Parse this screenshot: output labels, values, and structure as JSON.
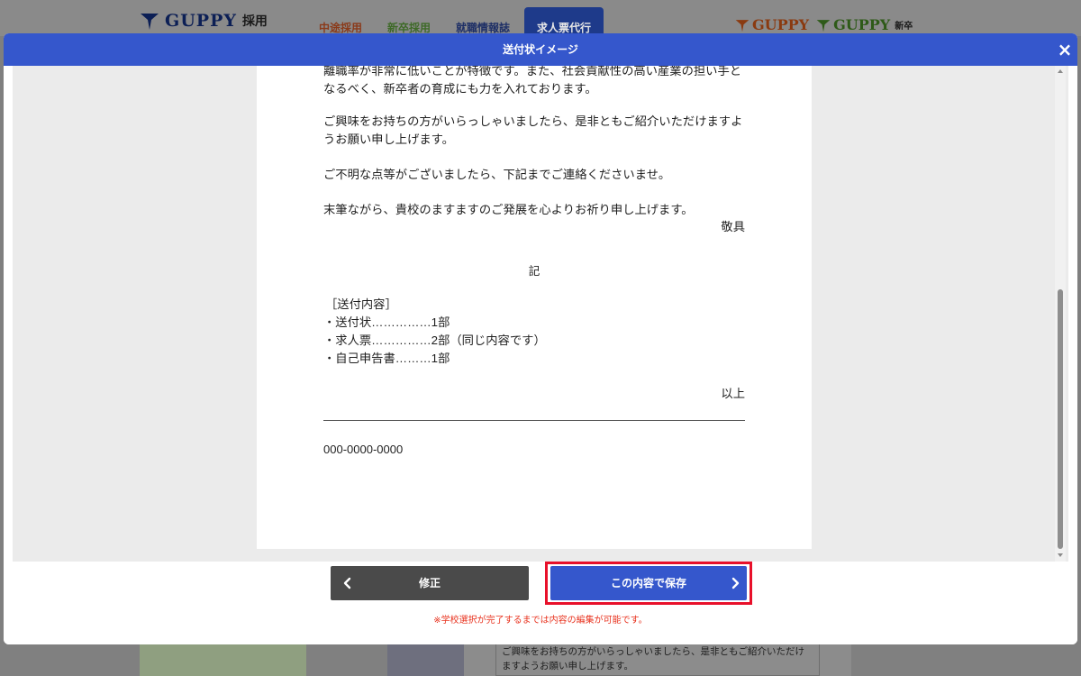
{
  "site": {
    "logo_text": "GUPPY",
    "logo_sub": "採用",
    "nav": [
      "中途採用",
      "新卒採用",
      "就職情報誌",
      "求人票代行"
    ],
    "brand1": "GUPPY",
    "brand2": "GUPPY",
    "brand2_sub": "新卒"
  },
  "modal": {
    "title": "送付状イメージ",
    "close_icon": "×",
    "letter": {
      "para1": "離職率が非常に低いことが特徴です。また、社会貢献性の高い産業の担い手となるべく、新卒者の育成にも力を入れております。",
      "para2": "ご興味をお持ちの方がいらっしゃいましたら、是非ともご紹介いただけますようお願い申し上げます。",
      "para3": "ご不明な点等がございましたら、下記までご連絡くださいませ。",
      "para4": "末筆ながら、貴校のますますのご発展を心よりお祈り申し上げます。",
      "closing": "敬具",
      "ki": "記",
      "contents_heading": "［送付内容］",
      "items": [
        "・送付状……………1部",
        "・求人票……………2部（同じ内容です）",
        "・自己申告書………1部"
      ],
      "ijo": "以上",
      "phone": "000-0000-0000"
    },
    "buttons": {
      "edit_label": "修正",
      "save_label": "この内容で保存"
    },
    "note": "※学校選択が完了するまでは内容の編集が可能です。"
  },
  "background_textbox": "ご興味をお持ちの方がいらっしゃいましたら、是非ともご紹介いただけますようお願い申し上げます。",
  "colors": {
    "modal_header": "#3557cc",
    "save_button": "#3557cc",
    "edit_button": "#4a4a4a",
    "highlight_frame": "#e8102a",
    "note_text": "#e8321e"
  }
}
